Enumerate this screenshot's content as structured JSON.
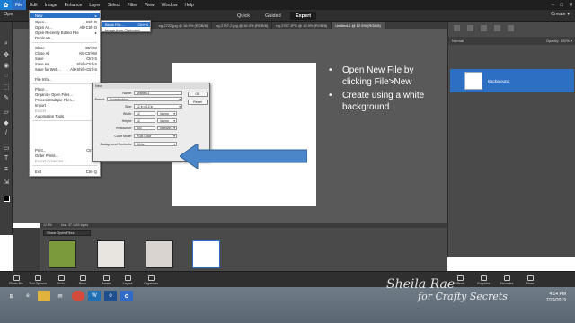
{
  "menubar": {
    "logo": "✿",
    "items": [
      "File",
      "Edit",
      "Image",
      "Enhance",
      "Layer",
      "Select",
      "Filter",
      "View",
      "Window",
      "Help"
    ]
  },
  "modebar": {
    "open_label": "Ope",
    "tabs": [
      "Quick",
      "Guided",
      "Expert"
    ],
    "create_label": "Create ▾"
  },
  "doc_tabs": [
    "rg-2717.jp...@ 16.9% (RGB/8)",
    "eg-2722.jpg @ 16.9% (RGB/8)",
    "eg-2707-2.jpg @ 16.3% (RGB/8)",
    "ng-2767.JPG @ 16.9% (RGB/8)",
    "Untitled-1 @ 12.5% (RGB/8)"
  ],
  "notes": [
    "Open New File by clicking File>New",
    "Create using a white background"
  ],
  "file_menu": {
    "items": [
      {
        "label": "New",
        "shortcut": "▸"
      },
      {
        "label": "Open...",
        "shortcut": "Ctrl+O"
      },
      {
        "label": "Open As...",
        "shortcut": "Alt+Ctrl+O"
      },
      {
        "label": "Open Recently Edited File",
        "shortcut": "▸"
      },
      {
        "label": "Duplicate...",
        "shortcut": ""
      },
      {
        "label": "Close",
        "shortcut": "Ctrl+W"
      },
      {
        "label": "Close All",
        "shortcut": "Alt+Ctrl+W"
      },
      {
        "label": "Save",
        "shortcut": "Ctrl+S"
      },
      {
        "label": "Save As...",
        "shortcut": "Shift+Ctrl+S"
      },
      {
        "label": "Save for Web...",
        "shortcut": "Alt+Shift+Ctrl+S"
      },
      {
        "label": "File Info...",
        "shortcut": ""
      },
      {
        "label": "Place...",
        "shortcut": ""
      },
      {
        "label": "Organize Open Files...",
        "shortcut": ""
      },
      {
        "label": "Process Multiple Files...",
        "shortcut": ""
      },
      {
        "label": "Import",
        "shortcut": "▸"
      },
      {
        "label": "Export",
        "shortcut": "▸"
      },
      {
        "label": "Automation Tools",
        "shortcut": "▸"
      },
      {
        "label": "Print...",
        "shortcut": "Ctrl+P"
      },
      {
        "label": "Order Prints...",
        "shortcut": ""
      },
      {
        "label": "Export Creations...",
        "shortcut": ""
      },
      {
        "label": "Exit",
        "shortcut": "Ctrl+Q"
      }
    ],
    "submenu": [
      {
        "label": "Blank File...",
        "shortcut": "Ctrl+N"
      },
      {
        "label": "Image from Clipboard",
        "shortcut": ""
      }
    ]
  },
  "dialog": {
    "title": "New",
    "name_label": "Name:",
    "name_value": "Untitled-1",
    "preset_label": "Preset:",
    "preset_value": "Scrapbooking",
    "size_label": "Size:",
    "size_value": "12 in x 12 in",
    "width_label": "Width:",
    "width_value": "12",
    "width_unit": "inches",
    "height_label": "Height:",
    "height_value": "12",
    "height_unit": "inches",
    "resolution_label": "Resolution:",
    "resolution_value": "300",
    "resolution_unit": "pixels/in...",
    "color_mode_label": "Color Mode:",
    "color_mode_value": "RGB Color",
    "background_label": "Background Contents:",
    "background_value": "White",
    "ok_label": "OK",
    "reset_label": "Reset"
  },
  "right_panel": {
    "normal_label": "Normal",
    "opacity_label": "Opacity: 100% ▾",
    "layer_name": "Background"
  },
  "statusbar": {
    "zoom": "12.5%",
    "doc": "Doc: 37.1M/0 bytes"
  },
  "bin": {
    "dropdown": "Show Open Files"
  },
  "appbar": {
    "left_buttons": [
      "Photo Bin",
      "Tool Options",
      "Undo",
      "Redo",
      "Rotate",
      "Layout",
      "Organizer"
    ],
    "right_buttons": [
      "Effects",
      "Graphics",
      "Favorites",
      "More"
    ]
  },
  "tray": {
    "time": "4:14 PM",
    "date": "7/29/2019"
  },
  "watermark": {
    "line1": "Sheila Rae",
    "line2": "for Crafty Secrets"
  },
  "colors": {
    "accent": "#2b6fc4",
    "arrow": "#4a86c8",
    "workspace": "#595959"
  },
  "icons": [
    "search-icon",
    "gear-icon",
    "chevron-down-icon",
    "windows-start-icon"
  ]
}
